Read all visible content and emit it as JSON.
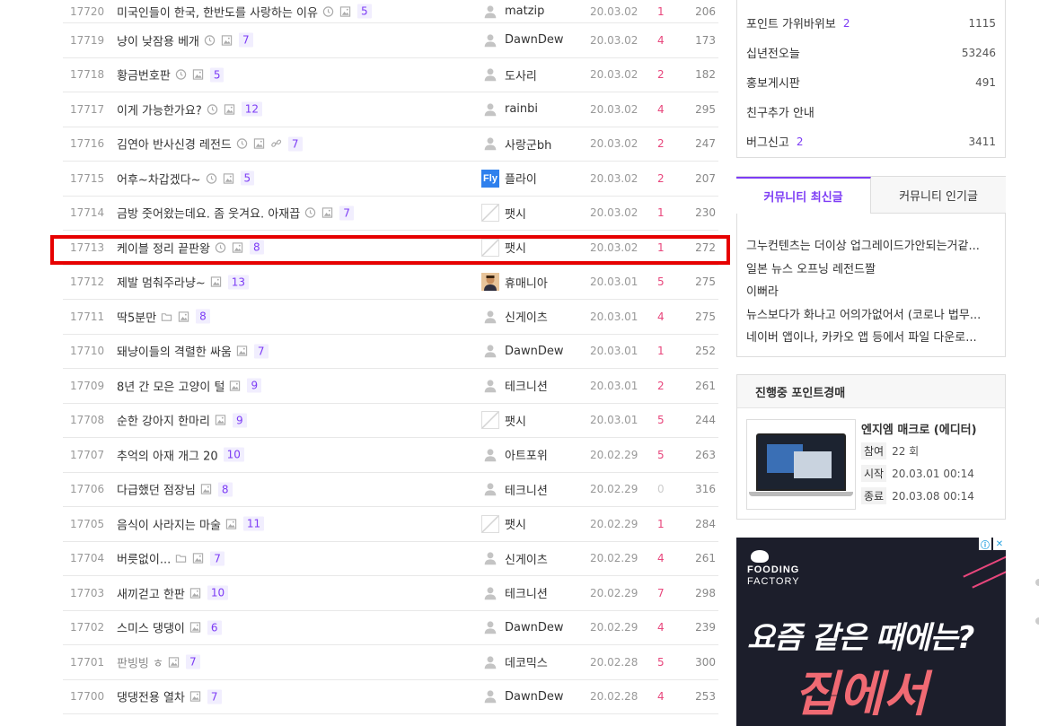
{
  "board": {
    "rows": [
      {
        "num": "17720",
        "title": "미국인들이 한국, 한반도를 사랑하는 이유",
        "icons": [
          "clock",
          "image"
        ],
        "comments": "5",
        "author": "matzip",
        "avatar": "default",
        "date": "20.03.02",
        "rec": "1",
        "views": "206"
      },
      {
        "num": "17719",
        "title": "냥이 낮잠용 베개",
        "icons": [
          "clock",
          "image"
        ],
        "comments": "7",
        "author": "DawnDew",
        "avatar": "default",
        "date": "20.03.02",
        "rec": "4",
        "views": "173"
      },
      {
        "num": "17718",
        "title": "황금번호판",
        "icons": [
          "clock",
          "image"
        ],
        "comments": "5",
        "author": "도사리",
        "avatar": "default",
        "date": "20.03.02",
        "rec": "2",
        "views": "182"
      },
      {
        "num": "17717",
        "title": "이게 가능한가요?",
        "icons": [
          "clock",
          "image"
        ],
        "comments": "12",
        "author": "rainbi",
        "avatar": "default",
        "date": "20.03.02",
        "rec": "4",
        "views": "295"
      },
      {
        "num": "17716",
        "title": "김연아 반사신경 레전드",
        "icons": [
          "clock",
          "image",
          "link"
        ],
        "comments": "7",
        "author": "사랑군bh",
        "avatar": "default",
        "date": "20.03.02",
        "rec": "2",
        "views": "247"
      },
      {
        "num": "17715",
        "title": "어후~차갑겠다~",
        "icons": [
          "clock",
          "image"
        ],
        "comments": "5",
        "author": "플라이",
        "avatar": "fly",
        "date": "20.03.02",
        "rec": "2",
        "views": "207"
      },
      {
        "num": "17714",
        "title": "금방 줏어왔는데요. 좀 웃겨요. 아재끕",
        "icons": [
          "clock",
          "image"
        ],
        "comments": "7",
        "author": "팻시",
        "avatar": "pattern",
        "date": "20.03.02",
        "rec": "1",
        "views": "230"
      },
      {
        "num": "17713",
        "title": "케이블 정리 끝판왕",
        "icons": [
          "clock",
          "image"
        ],
        "comments": "8",
        "author": "팻시",
        "avatar": "pattern",
        "date": "20.03.02",
        "rec": "1",
        "views": "272"
      },
      {
        "num": "17712",
        "title": "제발 멈춰주라냥~",
        "icons": [
          "image"
        ],
        "comments": "13",
        "author": "휴매니아",
        "avatar": "person",
        "date": "20.03.01",
        "rec": "5",
        "views": "275"
      },
      {
        "num": "17711",
        "title": "딱5분만",
        "icons": [
          "folder",
          "image"
        ],
        "comments": "8",
        "author": "신게이츠",
        "avatar": "default",
        "date": "20.03.01",
        "rec": "4",
        "views": "275"
      },
      {
        "num": "17710",
        "title": "돼냥이들의 격렬한 싸움",
        "icons": [
          "image"
        ],
        "comments": "7",
        "author": "DawnDew",
        "avatar": "default",
        "date": "20.03.01",
        "rec": "1",
        "views": "252"
      },
      {
        "num": "17709",
        "title": "8년 간 모은 고양이 털",
        "icons": [
          "image"
        ],
        "comments": "9",
        "author": "테크니션",
        "avatar": "default",
        "date": "20.03.01",
        "rec": "2",
        "views": "261"
      },
      {
        "num": "17708",
        "title": "순한 강아지 한마리",
        "icons": [
          "image"
        ],
        "comments": "9",
        "author": "팻시",
        "avatar": "pattern",
        "date": "20.03.01",
        "rec": "5",
        "views": "244"
      },
      {
        "num": "17707",
        "title": "추억의 아재 개그 20",
        "icons": [],
        "comments": "10",
        "author": "아트포위",
        "avatar": "default",
        "date": "20.02.29",
        "rec": "5",
        "views": "263"
      },
      {
        "num": "17706",
        "title": "다급했던 점장님",
        "icons": [
          "image"
        ],
        "comments": "8",
        "author": "테크니션",
        "avatar": "default",
        "date": "20.02.29",
        "rec": "0",
        "views": "316"
      },
      {
        "num": "17705",
        "title": "음식이 사라지는 마술",
        "icons": [
          "image"
        ],
        "comments": "11",
        "author": "팻시",
        "avatar": "pattern",
        "date": "20.02.29",
        "rec": "1",
        "views": "284"
      },
      {
        "num": "17704",
        "title": "버릇없이...",
        "icons": [
          "folder",
          "image"
        ],
        "comments": "7",
        "author": "신게이츠",
        "avatar": "default",
        "date": "20.02.29",
        "rec": "4",
        "views": "261"
      },
      {
        "num": "17703",
        "title": "새끼걷고 한판",
        "icons": [
          "image"
        ],
        "comments": "10",
        "author": "테크니션",
        "avatar": "default",
        "date": "20.02.29",
        "rec": "7",
        "views": "298"
      },
      {
        "num": "17702",
        "title": "스미스 댕댕이",
        "icons": [
          "image"
        ],
        "comments": "6",
        "author": "DawnDew",
        "avatar": "default",
        "date": "20.02.29",
        "rec": "4",
        "views": "239"
      },
      {
        "num": "17701",
        "title": "판빙빙 ㅎ",
        "icons": [
          "image"
        ],
        "comments": "7",
        "author": "데코믹스",
        "avatar": "default",
        "date": "20.02.28",
        "rec": "5",
        "views": "300",
        "muted": true
      },
      {
        "num": "17700",
        "title": "댕댕전용 열차",
        "icons": [
          "image"
        ],
        "comments": "7",
        "author": "DawnDew",
        "avatar": "default",
        "date": "20.02.28",
        "rec": "4",
        "views": "253"
      }
    ]
  },
  "sidebar": {
    "menu": [
      {
        "label": "포인트 가위바위보",
        "new": "2",
        "count": "1115"
      },
      {
        "label": "십년전오늘",
        "new": "",
        "count": "53246"
      },
      {
        "label": "홍보게시판",
        "new": "",
        "count": "491"
      },
      {
        "label": "친구추가 안내",
        "new": "",
        "count": ""
      },
      {
        "label": "버그신고",
        "new": "2",
        "count": "3411"
      }
    ],
    "tabs": {
      "active": "커뮤니티 최신글",
      "inactive": "커뮤니티 인기글"
    },
    "posts": [
      "그누컨텐츠는 더이상 업그레이드가안되는거같...",
      "일본 뉴스 오프닝 레전드짤",
      "이뻐라",
      "뉴스보다가 화나고 어의가없어서 (코로나 법무...",
      "네이버 앱이나, 카카오 앱 등에서 파일 다운로..."
    ],
    "auction": {
      "header": "진행중 포인트경매",
      "title": "엔지엠 매크로 (에디터)",
      "rows": [
        {
          "label": "참여",
          "value": "22 회"
        },
        {
          "label": "시작",
          "value": "20.03.01 00:14"
        },
        {
          "label": "종료",
          "value": "20.03.08 00:14"
        }
      ]
    },
    "ad": {
      "brand_line1": "FOODING",
      "brand_line2": "FACTORY",
      "headline": "요즘 같은 때에는?",
      "subheadline": "집에서",
      "adchoice_info": "ⓘ",
      "adchoice_close": "✕"
    }
  },
  "colors": {
    "accent": "#7d3cf5",
    "recommend": "#e8467c",
    "highlight": "#e60000"
  }
}
